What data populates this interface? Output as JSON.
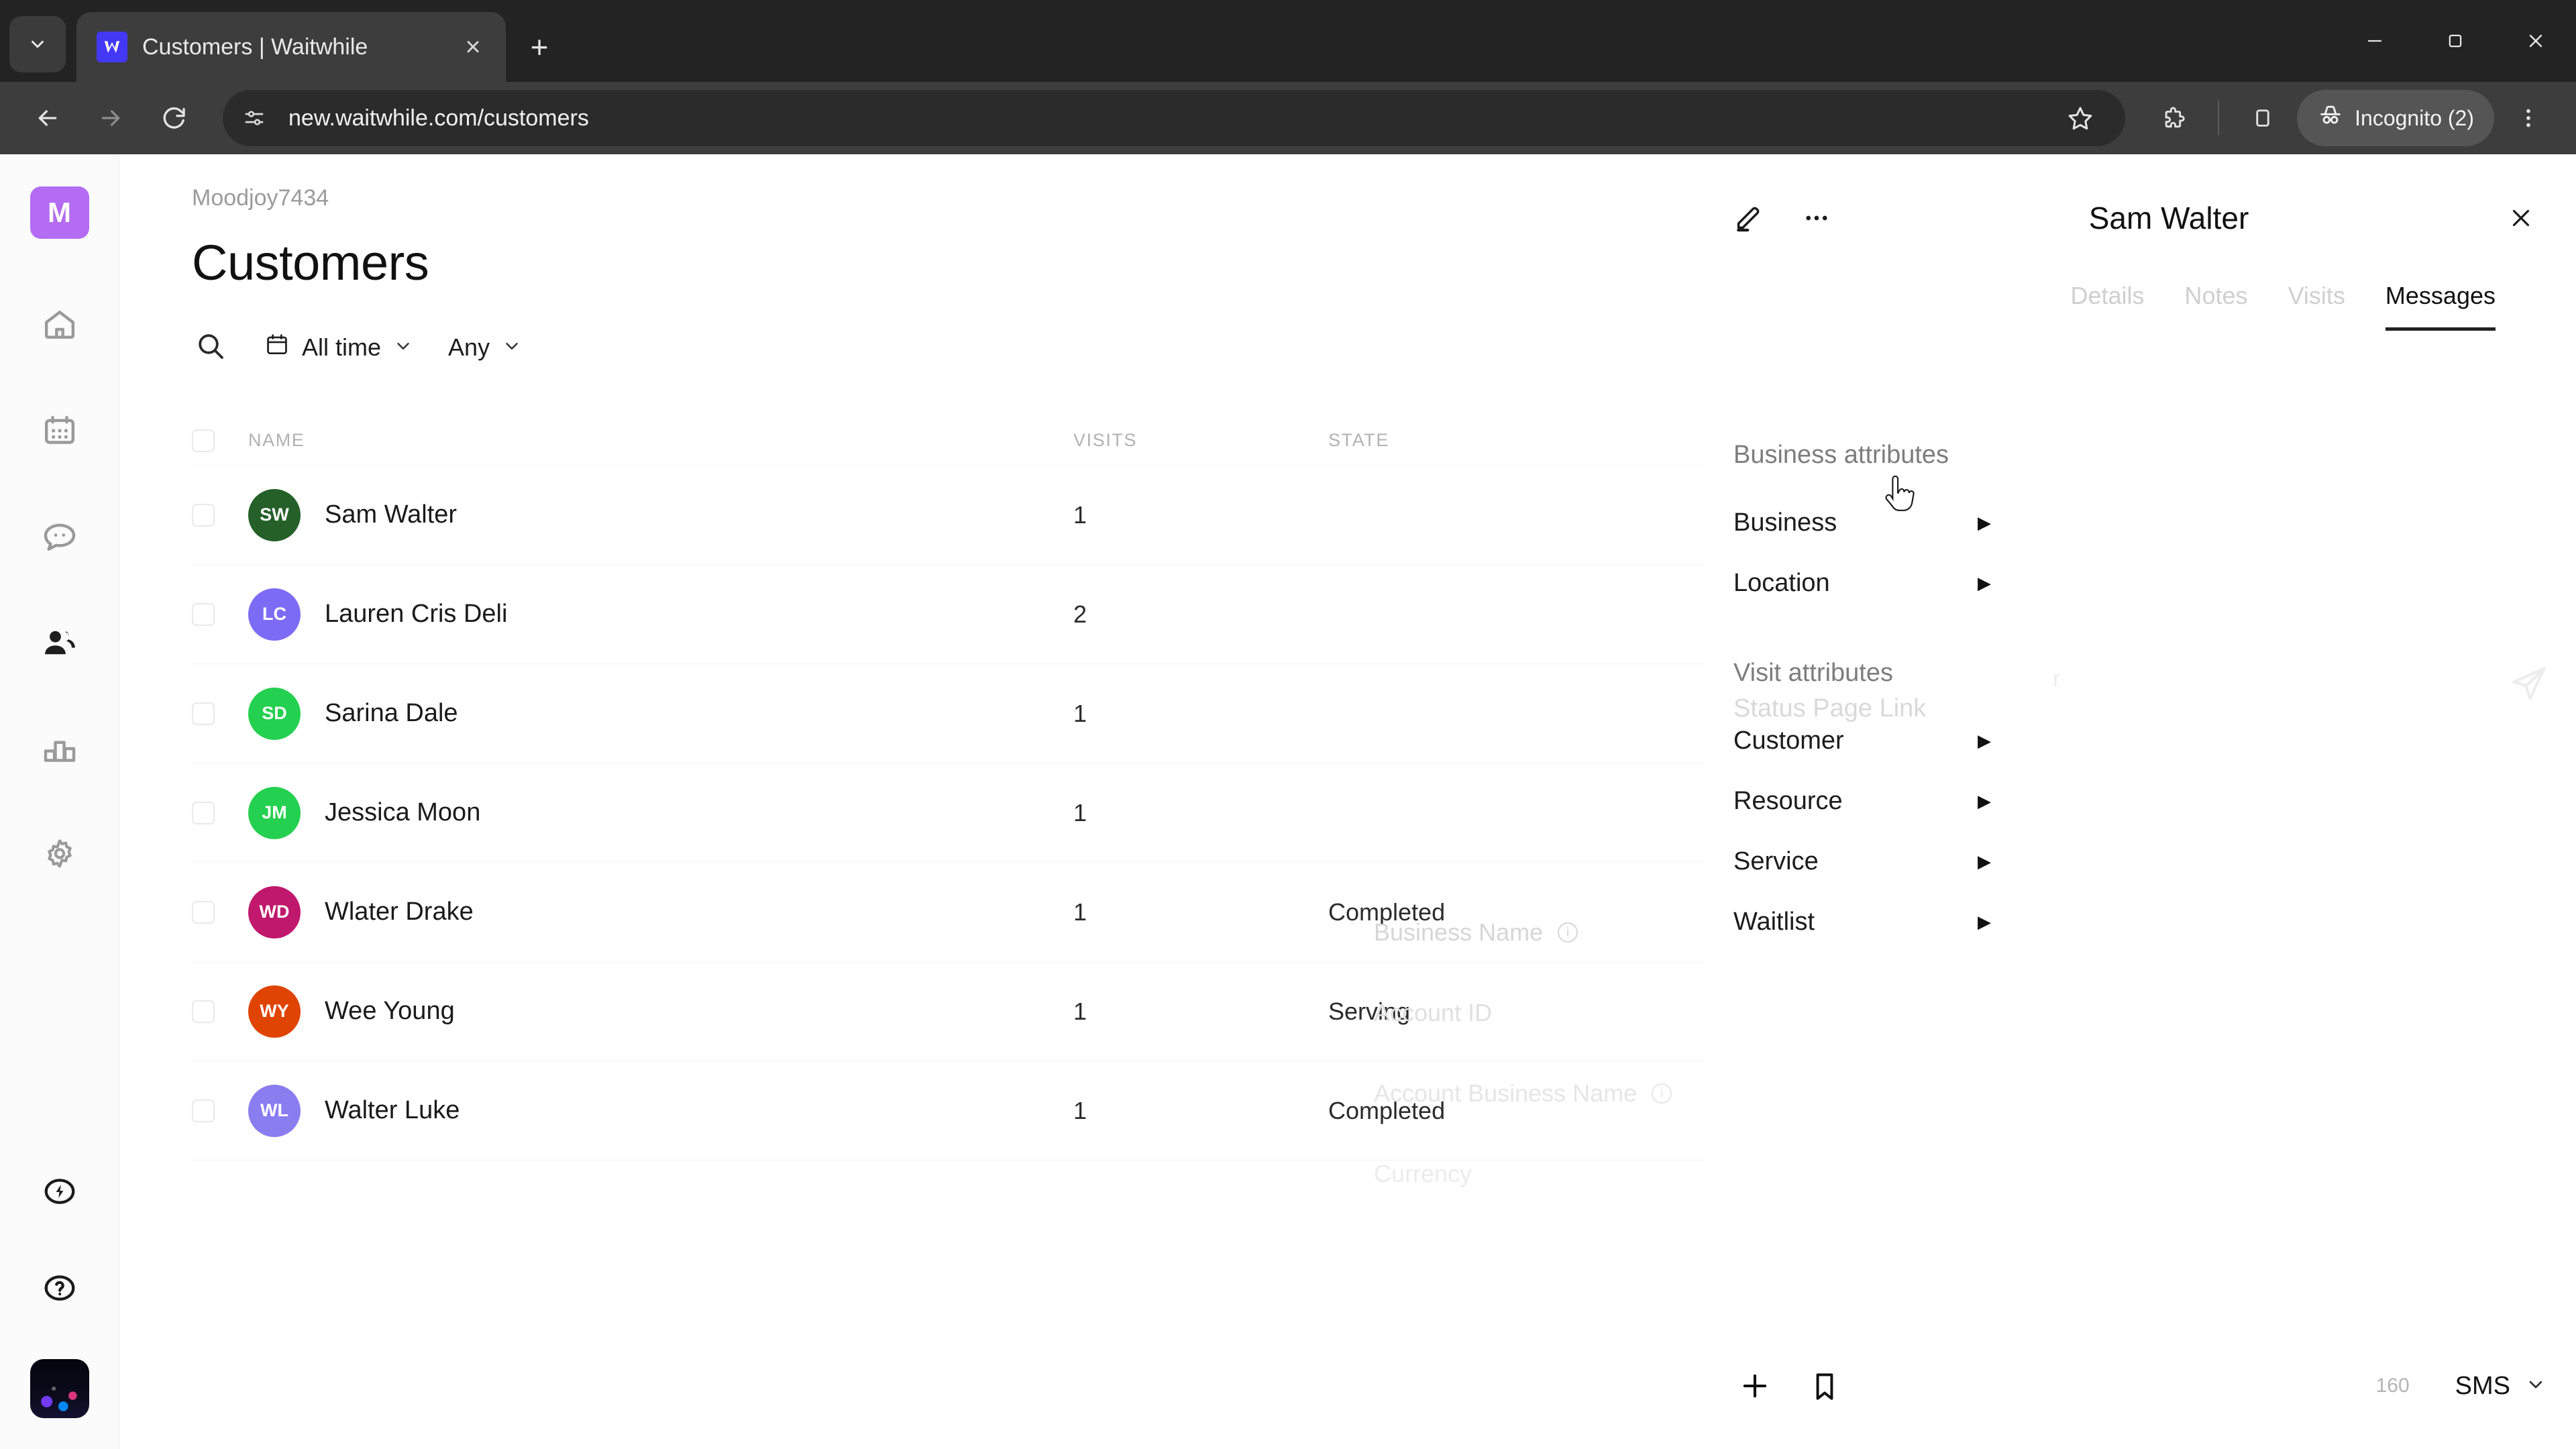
{
  "browser": {
    "tab": {
      "title": "Customers | Waitwhile",
      "favicon": "waitwhile-logo-icon",
      "close_label": "×"
    },
    "new_tab_label": "+",
    "tab_list_icon": "chevron-down-icon",
    "window": {
      "minimize": "—",
      "maximize": "□",
      "close": "×"
    },
    "toolbar": {
      "back_icon": "back-arrow-icon",
      "forward_icon": "forward-arrow-icon",
      "reload_icon": "reload-icon",
      "site_info_icon": "site-settings-icon",
      "url": "new.waitwhile.com/customers",
      "bookmark_icon": "star-icon",
      "extensions_icon": "puzzle-icon",
      "side_panel_icon": "side-panel-icon",
      "profile_label": "Incognito (2)",
      "profile_icon": "incognito-hat-icon",
      "menu_icon": "three-dot-menu-icon"
    }
  },
  "sidebar": {
    "brand_initial": "M",
    "brand_color": "#b36cf2",
    "items": [
      {
        "name": "home",
        "icon": "home-icon",
        "active": false
      },
      {
        "name": "calendar",
        "icon": "calendar-icon",
        "active": false
      },
      {
        "name": "messages",
        "icon": "chat-bubble-icon",
        "active": false
      },
      {
        "name": "customers",
        "icon": "people-icon",
        "active": true
      },
      {
        "name": "analytics",
        "icon": "bar-chart-icon",
        "active": false
      },
      {
        "name": "settings",
        "icon": "gear-icon",
        "active": false
      }
    ],
    "bottom_items": [
      {
        "name": "power",
        "icon": "lightning-circle-icon"
      },
      {
        "name": "help",
        "icon": "question-circle-icon"
      }
    ],
    "avatar": "user-avatar"
  },
  "main": {
    "breadcrumb": "Moodjoy7434",
    "title": "Customers",
    "filters": {
      "search_icon": "search-icon",
      "date_icon": "calendar-icon",
      "date_label": "All time",
      "state_label": "Any",
      "chevron": "⌄"
    },
    "table": {
      "columns": [
        "NAME",
        "VISITS",
        "STATE"
      ],
      "rows": [
        {
          "initials": "SW",
          "name": "Sam Walter",
          "visits": "1",
          "state": "",
          "color": "#256029"
        },
        {
          "initials": "LC",
          "name": "Lauren Cris Deli",
          "visits": "2",
          "state": "",
          "color": "#7c6cf5"
        },
        {
          "initials": "SD",
          "name": "Sarina Dale",
          "visits": "1",
          "state": "",
          "color": "#24d04f"
        },
        {
          "initials": "JM",
          "name": "Jessica Moon",
          "visits": "1",
          "state": "",
          "color": "#24d04f"
        },
        {
          "initials": "WD",
          "name": "Wlater Drake",
          "visits": "1",
          "state": "Completed",
          "color": "#c0186c"
        },
        {
          "initials": "WY",
          "name": "Wee Young",
          "visits": "1",
          "state": "Serving",
          "color": "#e04403"
        },
        {
          "initials": "WL",
          "name": "Walter Luke",
          "visits": "1",
          "state": "Completed",
          "color": "#8a7df0"
        }
      ]
    }
  },
  "panel": {
    "title": "Sam Walter",
    "edit_icon": "pencil-icon",
    "more_icon": "three-dot-menu-icon",
    "close_icon": "close-icon",
    "tabs": [
      {
        "label": "Details",
        "active": false
      },
      {
        "label": "Notes",
        "active": false
      },
      {
        "label": "Visits",
        "active": false
      },
      {
        "label": "Messages",
        "active": true
      }
    ],
    "attribute_menu": {
      "groups": [
        {
          "heading": "Business attributes",
          "items": [
            {
              "label": "Business",
              "hovered": true
            },
            {
              "label": "Location",
              "hovered": false
            }
          ]
        },
        {
          "heading": "Visit attributes",
          "items": [
            {
              "label": "Customer",
              "hovered": false
            },
            {
              "label": "Resource",
              "hovered": false
            },
            {
              "label": "Service",
              "hovered": false
            },
            {
              "label": "Waitlist",
              "hovered": false
            }
          ]
        }
      ],
      "caret": "▶"
    },
    "ghost_status_link": "Status Page Link",
    "send_icon": "send-paper-plane-icon",
    "composer": {
      "add_icon": "plus-icon",
      "template_icon": "bookmark-icon",
      "char_count": "160",
      "channel": "SMS",
      "channel_chevron": "⌄"
    }
  },
  "ghost_submenu": {
    "items": [
      {
        "label": "Business Name",
        "info": true
      },
      {
        "label": "Account ID",
        "info": false
      },
      {
        "label": "Account Business Name",
        "info": true
      },
      {
        "label": "Currency",
        "info": false
      },
      {
        "label": "",
        "info": false
      }
    ]
  }
}
